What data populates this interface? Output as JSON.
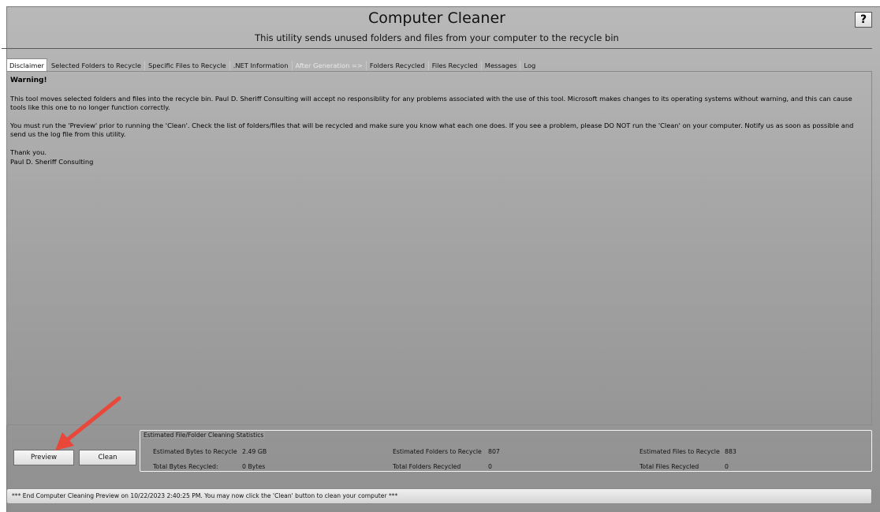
{
  "app": {
    "title": "Computer Cleaner",
    "subtitle": "This utility sends unused folders and files from your computer to the recycle bin",
    "help_label": "?"
  },
  "tabs": [
    {
      "label": "Disclaimer"
    },
    {
      "label": "Selected Folders to Recycle"
    },
    {
      "label": "Specific Files to Recycle"
    },
    {
      "label": ".NET Information"
    },
    {
      "label": "After Generation =>"
    },
    {
      "label": "Folders Recycled"
    },
    {
      "label": "Files Recycled"
    },
    {
      "label": "Messages"
    },
    {
      "label": "Log"
    }
  ],
  "disclaimer": {
    "heading": "Warning!",
    "paragraph1": "This tool moves selected folders and files into the recycle bin. Paul D. Sheriff Consulting will accept no responsiblity for any problems associated with the use of this tool. Microsoft makes changes to its operating systems without warning, and this can cause tools like this one to no longer function correctly.",
    "paragraph2": "You must run the 'Preview' prior to running the 'Clean'. Check the list of folders/files that will be recycled and make sure you know what each one does. If you see a problem, please DO NOT run the 'Clean' on your computer. Notify us as soon as possible and send us the log file from this utility.",
    "thanks": "Thank you.",
    "signature": "Paul D. Sheriff Consulting"
  },
  "buttons": {
    "preview": "Preview",
    "clean": "Clean"
  },
  "stats": {
    "legend": "Estimated File/Folder Cleaning Statistics",
    "est_bytes_label": "Estimated Bytes to Recycle",
    "est_bytes_value": "2.49 GB",
    "est_folders_label": "Estimated Folders to Recycle",
    "est_folders_value": "807",
    "est_files_label": "Estimated Files to Recycle",
    "est_files_value": "883",
    "total_bytes_label": "Total Bytes Recycled:",
    "total_bytes_value": "0 Bytes",
    "total_folders_label": "Total Folders Recycled",
    "total_folders_value": "0",
    "total_files_label": "Total Files Recycled",
    "total_files_value": "0"
  },
  "status": {
    "message": "*** End Computer Cleaning Preview on 10/22/2023 2:40:25 PM. You may now click the 'Clean' button to clean your computer ***"
  },
  "annotation": {
    "arrow_color": "#e8473a"
  }
}
